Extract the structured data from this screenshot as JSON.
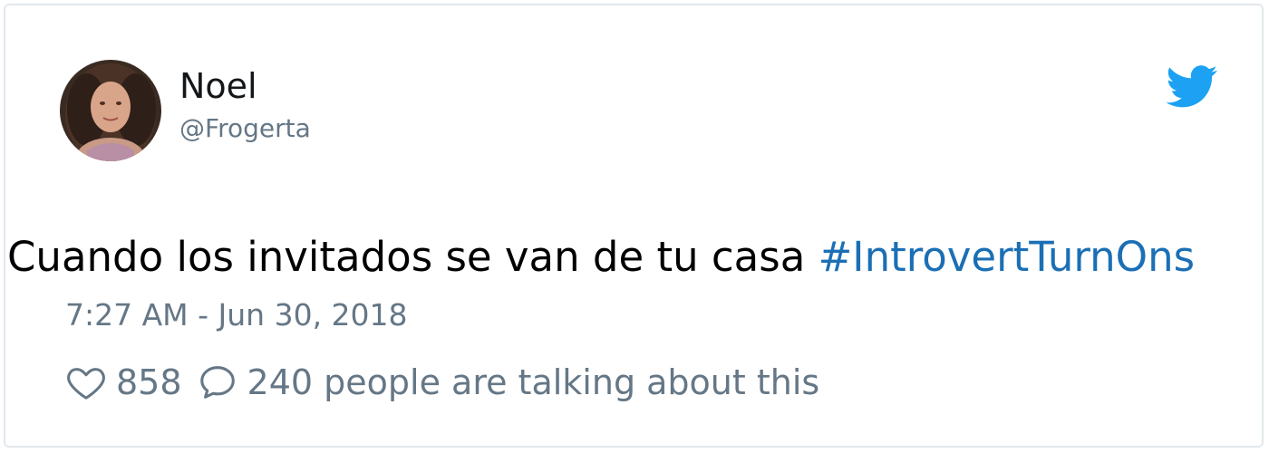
{
  "tweet": {
    "display_name": "Noel",
    "handle": "@Frogerta",
    "text": "Cuando los invitados se van de tu casa",
    "hashtag": "#IntrovertTurnOns",
    "timestamp": "7:27 AM - Jun 30, 2018",
    "likes": "858",
    "talking": "240 people are talking about this"
  },
  "icons": {
    "brand": "twitter-bird-icon",
    "like": "heart-outline-icon",
    "reply": "speech-bubble-icon"
  },
  "colors": {
    "brand": "#1da1f2",
    "hashtag": "#1b6fb5",
    "secondary_text": "#657786"
  }
}
